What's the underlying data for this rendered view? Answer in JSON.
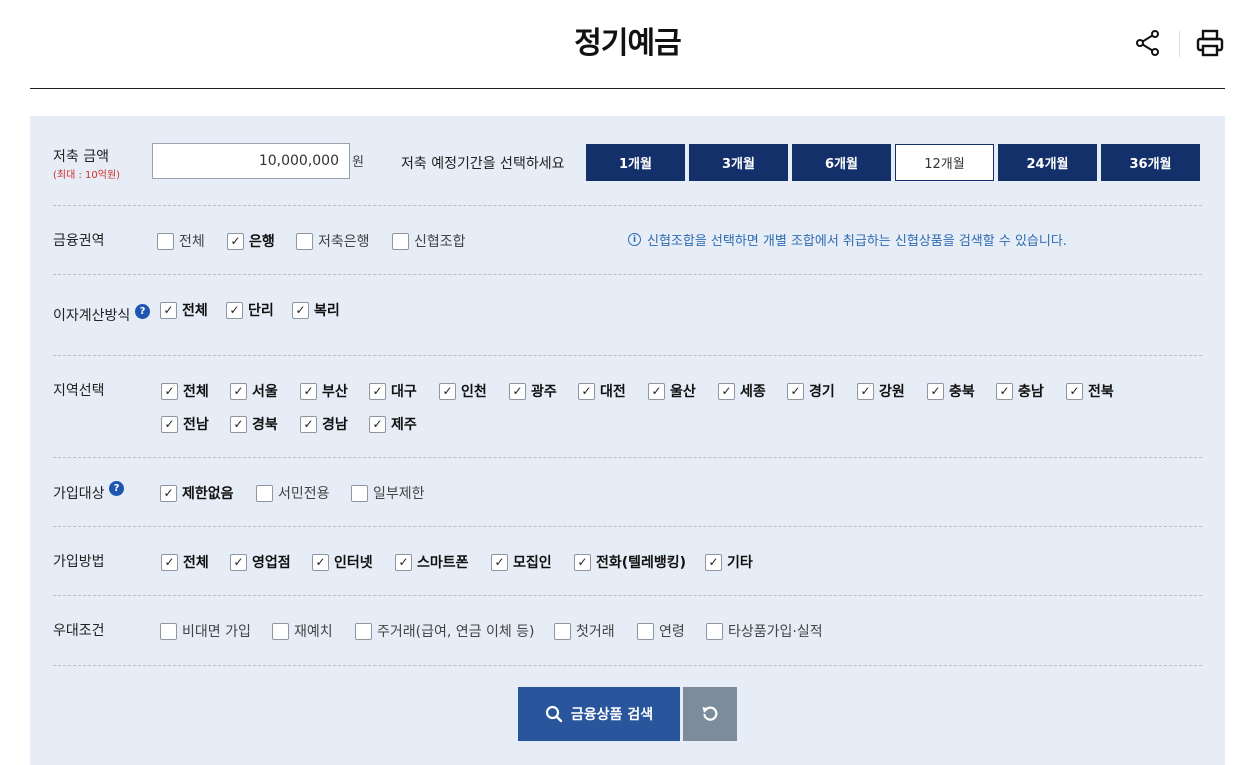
{
  "page": {
    "title": "정기예금"
  },
  "amount": {
    "label": "저축 금액",
    "sublabel": "(최대 : 10억원)",
    "value": "10,000,000",
    "unit": "원"
  },
  "period": {
    "label": "저축 예정기간을 선택하세요",
    "options": [
      "1개월",
      "3개월",
      "6개월",
      "12개월",
      "24개월",
      "36개월"
    ],
    "selected": "12개월"
  },
  "sector": {
    "label": "금융권역",
    "options": [
      {
        "label": "전체",
        "checked": false
      },
      {
        "label": "은행",
        "checked": true
      },
      {
        "label": "저축은행",
        "checked": false
      },
      {
        "label": "신협조합",
        "checked": false
      }
    ],
    "note": "신협조합을 선택하면 개별 조합에서 취급하는 신협상품을 검색할 수 있습니다."
  },
  "interest": {
    "label": "이자계산방식",
    "options": [
      {
        "label": "전체",
        "checked": true
      },
      {
        "label": "단리",
        "checked": true
      },
      {
        "label": "복리",
        "checked": true
      }
    ]
  },
  "region": {
    "label": "지역선택",
    "options": [
      {
        "label": "전체",
        "checked": true
      },
      {
        "label": "서울",
        "checked": true
      },
      {
        "label": "부산",
        "checked": true
      },
      {
        "label": "대구",
        "checked": true
      },
      {
        "label": "인천",
        "checked": true
      },
      {
        "label": "광주",
        "checked": true
      },
      {
        "label": "대전",
        "checked": true
      },
      {
        "label": "울산",
        "checked": true
      },
      {
        "label": "세종",
        "checked": true
      },
      {
        "label": "경기",
        "checked": true
      },
      {
        "label": "강원",
        "checked": true
      },
      {
        "label": "충북",
        "checked": true
      },
      {
        "label": "충남",
        "checked": true
      },
      {
        "label": "전북",
        "checked": true
      },
      {
        "label": "전남",
        "checked": true
      },
      {
        "label": "경북",
        "checked": true
      },
      {
        "label": "경남",
        "checked": true
      },
      {
        "label": "제주",
        "checked": true
      }
    ]
  },
  "eligibility": {
    "label": "가입대상",
    "options": [
      {
        "label": "제한없음",
        "checked": true
      },
      {
        "label": "서민전용",
        "checked": false
      },
      {
        "label": "일부제한",
        "checked": false
      }
    ]
  },
  "method": {
    "label": "가입방법",
    "options": [
      {
        "label": "전체",
        "checked": true
      },
      {
        "label": "영업점",
        "checked": true
      },
      {
        "label": "인터넷",
        "checked": true
      },
      {
        "label": "스마트폰",
        "checked": true
      },
      {
        "label": "모집인",
        "checked": true
      },
      {
        "label": "전화(텔레뱅킹)",
        "checked": true
      },
      {
        "label": "기타",
        "checked": true
      }
    ]
  },
  "benefit": {
    "label": "우대조건",
    "options": [
      {
        "label": "비대면 가입",
        "checked": false
      },
      {
        "label": "재예치",
        "checked": false
      },
      {
        "label": "주거래(급여, 연금 이체 등)",
        "checked": false
      },
      {
        "label": "첫거래",
        "checked": false
      },
      {
        "label": "연령",
        "checked": false
      },
      {
        "label": "타상품가입·실적",
        "checked": false
      }
    ]
  },
  "actions": {
    "search_label": "금융상품 검색",
    "help_glyph": "?",
    "info_glyph": "i",
    "check_glyph": "✓"
  },
  "icons": {
    "share": "share-icon",
    "print": "print-icon",
    "search": "search-icon",
    "reset": "refresh-icon"
  },
  "colors": {
    "panel_bg": "#e6edf6",
    "primary_navy": "#14306a",
    "search_button": "#28559c",
    "reset_button": "#7d8c9c",
    "info_text": "#2f6bb0",
    "max_note": "#d03030"
  }
}
